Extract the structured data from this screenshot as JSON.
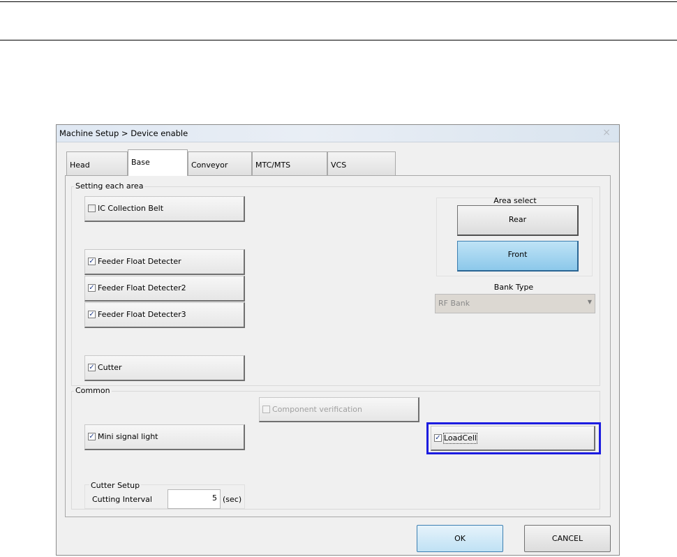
{
  "window": {
    "title": "Machine Setup > Device enable",
    "close_glyph": "×"
  },
  "tabs": [
    {
      "label": "Head",
      "active": false
    },
    {
      "label": "Base",
      "active": true
    },
    {
      "label": "Conveyor",
      "active": false
    },
    {
      "label": "MTC/MTS",
      "active": false
    },
    {
      "label": "VCS",
      "active": false
    }
  ],
  "setting_area": {
    "title": "Setting each area",
    "items": [
      {
        "label": "IC Collection Belt",
        "checked": false
      },
      {
        "label": "Feeder Float Detecter",
        "checked": true
      },
      {
        "label": "Feeder Float Detecter2",
        "checked": true
      },
      {
        "label": "Feeder Float Detecter3",
        "checked": true
      },
      {
        "label": "Cutter",
        "checked": true
      }
    ]
  },
  "area_select": {
    "title": "Area select",
    "rear_label": "Rear",
    "front_label": "Front",
    "selected": "Front"
  },
  "bank_type": {
    "label": "Bank Type",
    "value": "RF Bank",
    "arrow": "▼"
  },
  "common": {
    "title": "Common",
    "component_verification": {
      "label": "Component verification",
      "checked": false,
      "enabled": false
    },
    "mini_signal_light": {
      "label": "Mini signal light",
      "checked": true
    },
    "load_cell": {
      "label": "LoadCell",
      "checked": true
    }
  },
  "cutter_setup": {
    "title": "Cutter Setup",
    "interval_label": "Cutting Interval",
    "interval_value": "5",
    "unit": "(sec)"
  },
  "buttons": {
    "ok": "OK",
    "cancel": "CANCEL"
  },
  "colors": {
    "highlight": "#1c1ce0",
    "front_selected": "#8cc8ea"
  },
  "check_glyph": "✓"
}
